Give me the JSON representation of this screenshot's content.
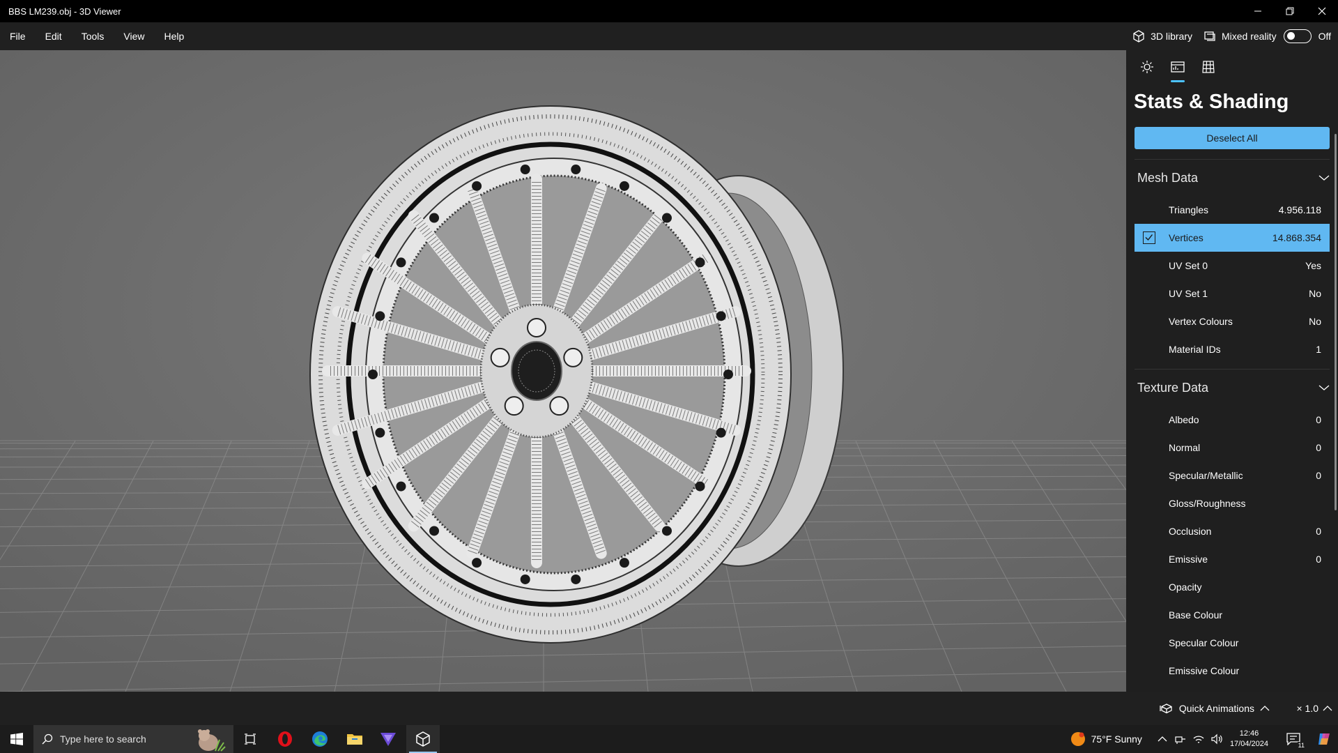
{
  "window": {
    "title": "BBS LM239.obj - 3D Viewer",
    "controls": [
      "minimize-icon",
      "restore-icon",
      "close-icon"
    ]
  },
  "menu": {
    "items": [
      "File",
      "Edit",
      "Tools",
      "View",
      "Help"
    ],
    "library_label": "3D library",
    "mixed_reality_label": "Mixed reality",
    "mixed_reality_state": "Off"
  },
  "panel": {
    "tabs": [
      "lighting-icon",
      "stats-icon",
      "grid-icon"
    ],
    "title": "Stats & Shading",
    "deselect_label": "Deselect All",
    "mesh": {
      "label": "Mesh Data",
      "rows": [
        {
          "name": "Triangles",
          "value": "4.956.118"
        },
        {
          "name": "Vertices",
          "value": "14.868.354"
        },
        {
          "name": "UV Set 0",
          "value": "Yes"
        },
        {
          "name": "UV Set 1",
          "value": "No"
        },
        {
          "name": "Vertex Colours",
          "value": "No"
        },
        {
          "name": "Material IDs",
          "value": "1"
        }
      ]
    },
    "texture": {
      "label": "Texture Data",
      "rows": [
        {
          "name": "Albedo",
          "value": "0"
        },
        {
          "name": "Normal",
          "value": "0"
        },
        {
          "name": "Specular/Metallic",
          "value": "0"
        },
        {
          "name": "Gloss/Roughness",
          "value": ""
        },
        {
          "name": "Occlusion",
          "value": "0"
        },
        {
          "name": "Emissive",
          "value": "0"
        },
        {
          "name": "Opacity",
          "value": ""
        },
        {
          "name": "Base Colour",
          "value": ""
        },
        {
          "name": "Specular Colour",
          "value": ""
        },
        {
          "name": "Emissive Colour",
          "value": ""
        }
      ]
    }
  },
  "bottombar": {
    "quick_animations": "Quick Animations",
    "speed": "× 1.0"
  },
  "taskbar": {
    "search_placeholder": "Type here to search",
    "weather": "75°F  Sunny",
    "time": "12:46",
    "date": "17/04/2024",
    "notification_count": "11"
  },
  "colors": {
    "accent": "#60b8f2",
    "viewport": "#6e6e6e",
    "panel": "#1f1f1f"
  }
}
